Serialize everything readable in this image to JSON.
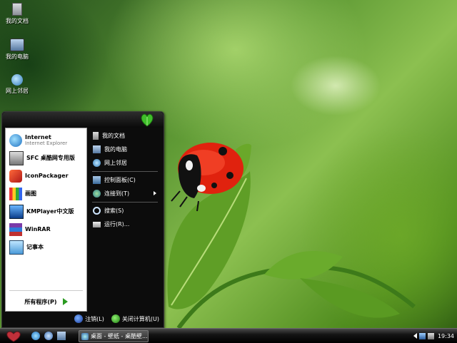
{
  "desktop": {
    "icons": [
      {
        "label": "我的文档",
        "icon": "my-documents-icon"
      },
      {
        "label": "我的电脑",
        "icon": "my-computer-icon"
      },
      {
        "label": "网上邻居",
        "icon": "network-places-icon"
      }
    ]
  },
  "start_menu": {
    "pinned": [
      {
        "title": "Internet",
        "subtitle": "Internet Explorer",
        "icon": "internet-explorer-icon"
      },
      {
        "title": "SFC 桌酷网专用版",
        "icon": "sfc-icon"
      },
      {
        "title": "IconPackager",
        "icon": "iconpackager-icon"
      },
      {
        "title": "画图",
        "icon": "paint-icon"
      },
      {
        "title": "KMPlayer中文版",
        "icon": "kmplayer-icon"
      },
      {
        "title": "WinRAR",
        "icon": "winrar-icon"
      },
      {
        "title": "记事本",
        "icon": "notepad-icon"
      }
    ],
    "all_programs": "所有程序(P)",
    "places": [
      {
        "label": "我的文档",
        "icon": "my-documents-icon"
      },
      {
        "label": "我的电脑",
        "icon": "my-computer-icon"
      },
      {
        "label": "网上邻居",
        "icon": "network-places-icon"
      }
    ],
    "settings": [
      {
        "label": "控制面板(C)",
        "icon": "control-panel-icon"
      },
      {
        "label": "连接到(T)",
        "icon": "connect-to-icon"
      }
    ],
    "tools": [
      {
        "label": "搜索(S)",
        "icon": "search-icon"
      },
      {
        "label": "运行(R)...",
        "icon": "run-icon"
      }
    ],
    "logoff": "注销(L)",
    "shutdown": "关闭计算机(U)"
  },
  "taskbar": {
    "window_title": "桌面 - 壁纸 - 桌酷壁...",
    "clock": "19:34"
  },
  "colors": {
    "start_menu_bg": "#0c0c0c",
    "leaf_green": "#2a9a20",
    "taskbar_bg": "#000000"
  }
}
